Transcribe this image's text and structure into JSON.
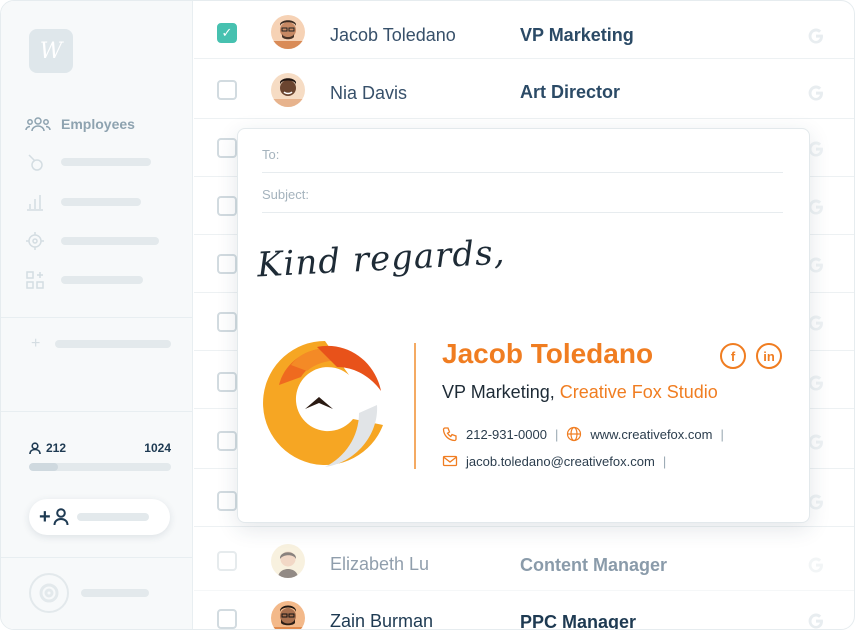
{
  "sidebar": {
    "logo": "W",
    "nav": {
      "employees_label": "Employees"
    },
    "counts": {
      "assigned": "212",
      "total": "1024",
      "progress": 0.207
    }
  },
  "employees": [
    {
      "name": "Jacob Toledano",
      "role": "VP Marketing",
      "checked": true
    },
    {
      "name": "Nia Davis",
      "role": "Art Director",
      "checked": false
    },
    {
      "name": "Elizabeth Lu",
      "role": "Content Manager",
      "checked": false
    },
    {
      "name": "Zain Burman",
      "role": "PPC Manager",
      "checked": false
    }
  ],
  "email": {
    "to_label": "To:",
    "subject_label": "Subject:",
    "signoff": "Kind regards,",
    "signature": {
      "name": "Jacob Toledano",
      "title": "VP Marketing,",
      "company": "Creative Fox Studio",
      "phone": "212-931-0000",
      "website": "www.creativefox.com",
      "email": "jacob.toledano@creativefox.com",
      "separator": "|",
      "social": [
        "f",
        "in"
      ]
    }
  },
  "colors": {
    "accent": "#f07d21",
    "check": "#47c1b0",
    "text_dark": "#1e3a52"
  }
}
